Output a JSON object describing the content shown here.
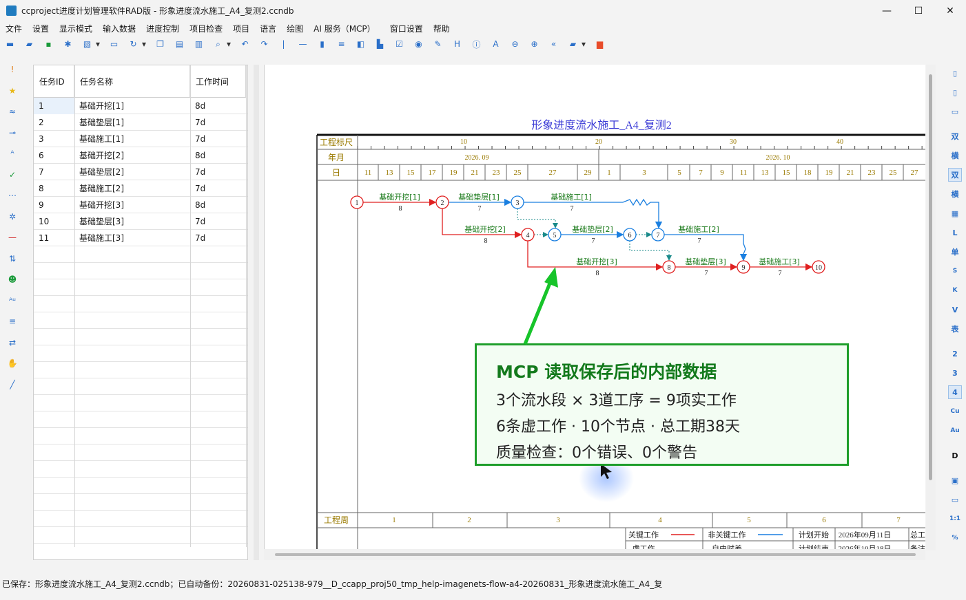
{
  "window": {
    "title": "ccproject进度计划管理软件RAD版 - 形象进度流水施工_A4_复测2.ccndb",
    "minimize": "—",
    "maximize": "☐",
    "close": "✕"
  },
  "menu": [
    "文件",
    "设置",
    "显示模式",
    "输入数据",
    "进度控制",
    "项目检查",
    "项目",
    "语言",
    "绘图",
    "AI 服务（MCP）",
    "窗口设置",
    "帮助"
  ],
  "toolbar_icons": [
    "new-icon",
    "open-icon",
    "save-icon",
    "star-icon",
    "export-icon",
    "dropdown-icon",
    "print-icon",
    "refresh-icon",
    "dropdown-icon",
    "copy-icon",
    "paste-icon",
    "format-icon",
    "search-icon",
    "dropdown-icon",
    "undo-icon",
    "redo-icon",
    "separator",
    "line-icon",
    "column-icon",
    "sort-icon",
    "contrast-icon",
    "paint-icon",
    "check-icon",
    "palette-icon",
    "edit-icon",
    "h-icon",
    "info-icon",
    "a-icon",
    "zoom-out-icon",
    "zoom-in-icon",
    "back-icon",
    "folder-icon",
    "dropdown-icon",
    "briefcase-icon"
  ],
  "left_icons": [
    "exclamation-icon",
    "star-icon",
    "wave-icon",
    "link-icon",
    "text-icon",
    "check-icon",
    "dots-icon",
    "gear-icon",
    "minus-icon",
    "sort-icon",
    "users-icon",
    "au-icon",
    "filter-icon",
    "swap-icon",
    "hand-icon",
    "pen-icon"
  ],
  "right_labels": [
    "▯",
    "▯",
    "▭",
    "双",
    "横",
    "双",
    "横",
    "▦",
    "L",
    "单",
    "S",
    "K",
    "V",
    "表",
    "2",
    "3",
    "4",
    "Cu",
    "Au",
    "D",
    "▣",
    "▭",
    "1:1",
    "%"
  ],
  "grid": {
    "headers": [
      "任务ID",
      "任务名称",
      "工作时间"
    ],
    "rows": [
      {
        "id": "1",
        "name": "基础开挖[1]",
        "duration": "8d"
      },
      {
        "id": "2",
        "name": "基础垫层[1]",
        "duration": "7d"
      },
      {
        "id": "3",
        "name": "基础施工[1]",
        "duration": "7d"
      },
      {
        "id": "6",
        "name": "基础开挖[2]",
        "duration": "8d"
      },
      {
        "id": "7",
        "name": "基础垫层[2]",
        "duration": "7d"
      },
      {
        "id": "8",
        "name": "基础施工[2]",
        "duration": "7d"
      },
      {
        "id": "9",
        "name": "基础开挖[3]",
        "duration": "8d"
      },
      {
        "id": "10",
        "name": "基础垫层[3]",
        "duration": "7d"
      },
      {
        "id": "11",
        "name": "基础施工[3]",
        "duration": "7d"
      }
    ]
  },
  "chart": {
    "title": "形象进度流水施工_A4_复测2",
    "row_labels": {
      "scale": "工程标尺",
      "month": "年月",
      "day": "日",
      "week": "工程周"
    },
    "scale_ticks": [
      "10",
      "20",
      "30",
      "40"
    ],
    "months": [
      "2026. 09",
      "2026. 10"
    ],
    "days": [
      "11",
      "13",
      "15",
      "17",
      "19",
      "21",
      "23",
      "25",
      "27",
      "29",
      "1",
      "3",
      "5",
      "7",
      "9",
      "11",
      "13",
      "15",
      "18",
      "19",
      "21",
      "23",
      "25",
      "27"
    ],
    "weeks": [
      "1",
      "2",
      "3",
      "4",
      "5",
      "6",
      "7"
    ],
    "nodes": [
      "1",
      "2",
      "3",
      "4",
      "5",
      "6",
      "7",
      "8",
      "9",
      "10"
    ],
    "activities": [
      {
        "name": "基础开挖[1]",
        "dur": "8"
      },
      {
        "name": "基础垫层[1]",
        "dur": "7"
      },
      {
        "name": "基础施工[1]",
        "dur": "7"
      },
      {
        "name": "基础开挖[2]",
        "dur": "8"
      },
      {
        "name": "基础垫层[2]",
        "dur": "7"
      },
      {
        "name": "基础施工[2]",
        "dur": "7"
      },
      {
        "name": "基础开挖[3]",
        "dur": "8"
      },
      {
        "name": "基础垫层[3]",
        "dur": "7"
      },
      {
        "name": "基础施工[3]",
        "dur": "7"
      }
    ],
    "legend": {
      "critical": "关键工作",
      "noncritical": "非关键工作",
      "plan_start": "计划开始",
      "plan_start_value": "2026年09月11日",
      "total": "总工",
      "dummy": "虚工作",
      "free_float": "自由时差",
      "plan_end": "计划结束",
      "plan_end_value": "2026年10月18日",
      "cost": "备注"
    },
    "colors": {
      "critical": "#e02020",
      "noncritical": "#1a7fe0",
      "label": "#1a7a1a",
      "title": "#3a3ad6",
      "scale_text": "#9a7a00"
    }
  },
  "callout": {
    "title": "MCP 读取保存后的内部数据",
    "lines": [
      "3个流水段 × 3道工序 = 9项实工作",
      "6条虚工作 · 10个节点 · 总工期38天",
      "质量检查：0个错误、0个警告"
    ]
  },
  "status": "已保存：形象进度流水施工_A4_复测2.ccndb；已自动备份：20260831-025138-979__D_ccapp_proj50_tmp_help-imagenets-flow-a4-20260831_形象进度流水施工_A4_复"
}
